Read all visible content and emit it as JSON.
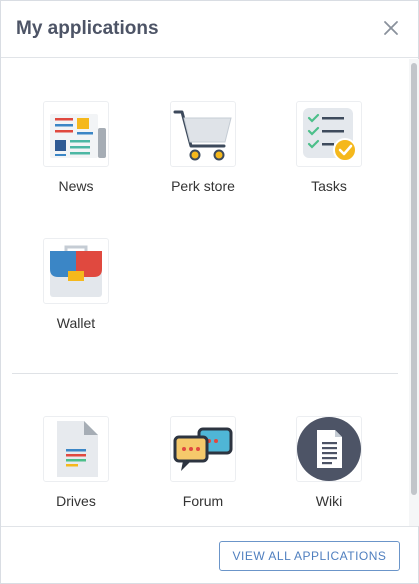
{
  "header": {
    "title": "My applications"
  },
  "sections": [
    {
      "apps": [
        {
          "label": "News",
          "icon": "news-icon"
        },
        {
          "label": "Perk store",
          "icon": "cart-icon"
        },
        {
          "label": "Tasks",
          "icon": "tasks-icon"
        },
        {
          "label": "Wallet",
          "icon": "wallet-icon"
        }
      ]
    },
    {
      "apps": [
        {
          "label": "Drives",
          "icon": "document-icon"
        },
        {
          "label": "Forum",
          "icon": "chat-bubbles-icon"
        },
        {
          "label": "Wiki",
          "icon": "wiki-page-icon"
        }
      ]
    }
  ],
  "footer": {
    "view_all_label": "VIEW ALL APPLICATIONS"
  },
  "colors": {
    "title": "#4d5466",
    "accent": "#4f7fbf"
  }
}
